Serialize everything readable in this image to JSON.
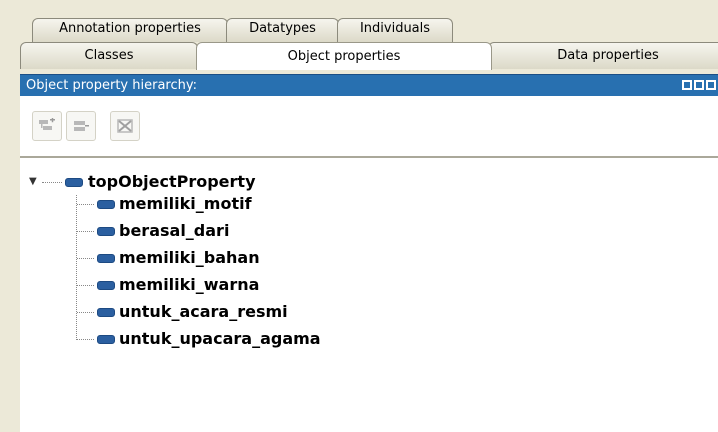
{
  "tabs": {
    "row1": [
      "Annotation properties",
      "Datatypes",
      "Individuals"
    ],
    "row2": [
      "Classes",
      "Object properties",
      "Data properties"
    ],
    "active": "Object properties"
  },
  "panel": {
    "title": "Object property hierarchy:"
  },
  "toolbar": {
    "buttons": [
      "add-subproperty-icon",
      "add-sibling-property-icon",
      "delete-property-icon"
    ]
  },
  "tree": {
    "root": "topObjectProperty",
    "children": [
      "memiliki_motif",
      "berasal_dari",
      "memiliki_bahan",
      "memiliki_warna",
      "untuk_acara_resmi",
      "untuk_upacara_agama"
    ]
  },
  "colors": {
    "titlebar": "#2870b0",
    "property_icon": "#2b5fa0",
    "tab_background": "#ece9d8"
  }
}
